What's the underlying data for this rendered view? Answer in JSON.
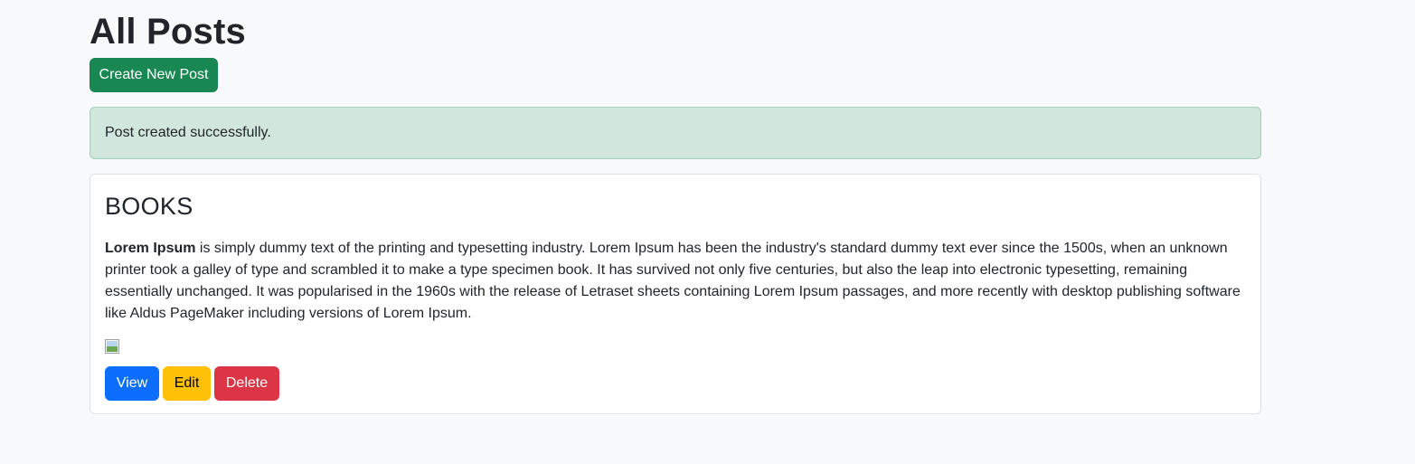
{
  "page": {
    "title": "All Posts"
  },
  "toolbar": {
    "create_label": "Create New Post"
  },
  "alert": {
    "message": "Post created successfully."
  },
  "posts": [
    {
      "title": "BOOKS",
      "body_bold": "Lorem Ipsum",
      "body_rest": " is simply dummy text of the printing and typesetting industry. Lorem Ipsum has been the industry's standard dummy text ever since the 1500s, when an unknown printer took a galley of type and scrambled it to make a type specimen book. It has survived not only five centuries, but also the leap into electronic typesetting, remaining essentially unchanged. It was popularised in the 1960s with the release of Letraset sheets containing Lorem Ipsum passages, and more recently with desktop publishing software like Aldus PageMaker including versions of Lorem Ipsum.",
      "image_icon": "broken-image-icon",
      "actions": {
        "view_label": "View",
        "edit_label": "Edit",
        "delete_label": "Delete"
      }
    }
  ],
  "colors": {
    "success": "#198754",
    "primary": "#0d6efd",
    "warning": "#ffc107",
    "danger": "#dc3545",
    "alert_bg": "#d1e7dd",
    "page_bg": "#f8f9fa"
  }
}
